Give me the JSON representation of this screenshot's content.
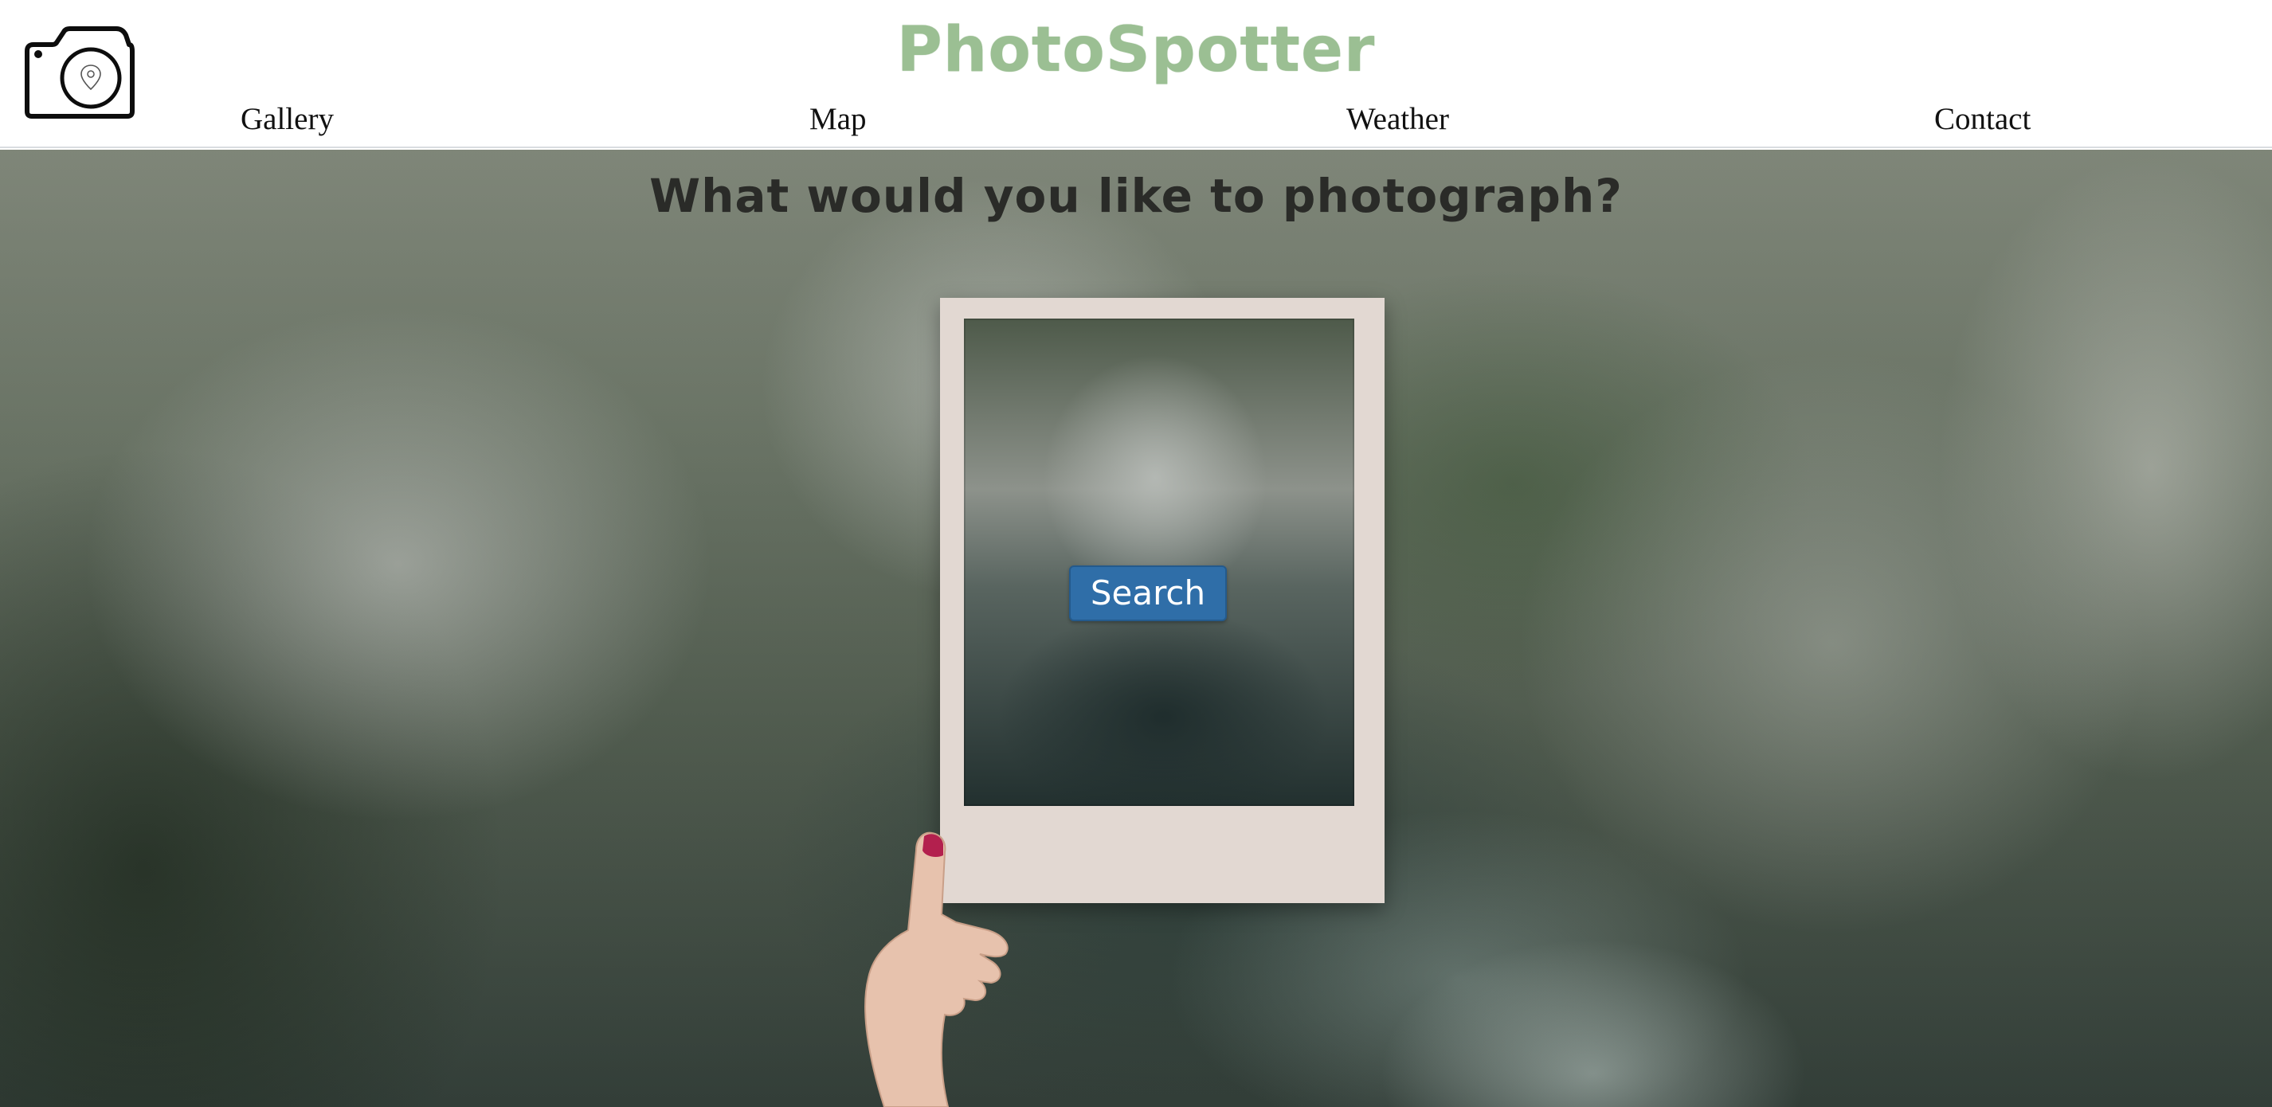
{
  "header": {
    "brand": "PhotoSpotter",
    "logo_icon": "camera-location-icon",
    "nav": [
      {
        "label": "Gallery"
      },
      {
        "label": "Map"
      },
      {
        "label": "Weather"
      },
      {
        "label": "Contact"
      }
    ]
  },
  "hero": {
    "heading": "What would you like to photograph?",
    "search_label": "Search"
  },
  "colors": {
    "brand": "#9bbf93",
    "button": "#2f6ea8",
    "heading": "#2a2b28"
  }
}
